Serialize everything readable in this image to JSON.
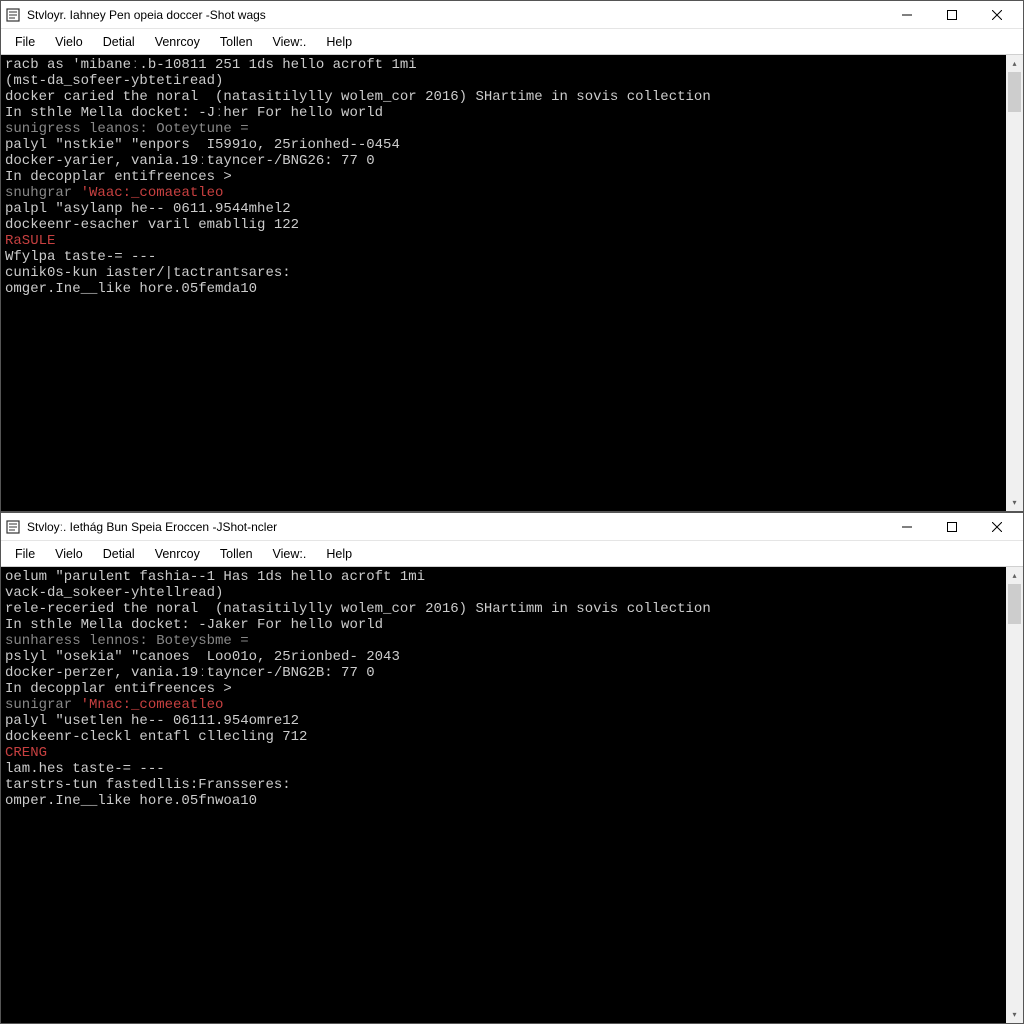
{
  "windows": [
    {
      "title": "Stvloyr. Iahney Pen opeia doccer -Shot wags",
      "menu": [
        "File",
        "Vielo",
        "Detial",
        "Venrcoy",
        "Tollen",
        "View:.",
        "Help"
      ],
      "lines": [
        {
          "segs": [
            {
              "t": "racb as 'mibaneː.b-10811 251 1ds hello acroft 1mi",
              "c": "white"
            }
          ]
        },
        {
          "segs": [
            {
              "t": "(mst-da_sofeer-ybtetiread)",
              "c": "white"
            }
          ]
        },
        {
          "segs": [
            {
              "t": "",
              "c": "white"
            }
          ]
        },
        {
          "segs": [
            {
              "t": "docker caried the noral  (natasitilylly wolem_cor 2016) SHartime in sovis collection",
              "c": "white"
            }
          ]
        },
        {
          "segs": [
            {
              "t": "",
              "c": "white"
            }
          ]
        },
        {
          "segs": [
            {
              "t": "In sthle Mella docket: -Jːher For hello world",
              "c": "white"
            }
          ]
        },
        {
          "segs": [
            {
              "t": "sunigress leanos: Ooteytune =",
              "c": "gray"
            }
          ]
        },
        {
          "segs": [
            {
              "t": "palyl \"nstkie\" \"enpors  I5991o, 25rionhed--0454",
              "c": "white"
            }
          ]
        },
        {
          "segs": [
            {
              "t": "docker-yarier, vania.19ːtayncer-/BNG26: 77 0",
              "c": "white"
            }
          ]
        },
        {
          "segs": [
            {
              "t": "",
              "c": "white"
            }
          ]
        },
        {
          "segs": [
            {
              "t": "In decopplar entifreences >",
              "c": "white"
            }
          ]
        },
        {
          "segs": [
            {
              "t": "snuhgrar ",
              "c": "gray"
            },
            {
              "t": "'Waac:_comaeatleo",
              "c": "red"
            }
          ]
        },
        {
          "segs": [
            {
              "t": "palpl \"asylanp he-- 0611.9544mhel2",
              "c": "white"
            }
          ]
        },
        {
          "segs": [
            {
              "t": "dockeenr-esacher varil emabllig 122",
              "c": "white"
            }
          ]
        },
        {
          "segs": [
            {
              "t": "RaSULE",
              "c": "red"
            }
          ]
        },
        {
          "segs": [
            {
              "t": "Wfylpa taste-= ---",
              "c": "white"
            }
          ]
        },
        {
          "segs": [
            {
              "t": "cunik0s-kun iaster/|tactrantsares:",
              "c": "white"
            }
          ]
        },
        {
          "segs": [
            {
              "t": "omger.Ine__like hore.05femda10",
              "c": "white"
            }
          ]
        }
      ]
    },
    {
      "title": "Stvloyː. Iethág Bun Speia Eroccen -JShot-ncler",
      "menu": [
        "File",
        "Vielo",
        "Detial",
        "Venrcoy",
        "Tollen",
        "View:.",
        "Help"
      ],
      "lines": [
        {
          "segs": [
            {
              "t": "oelum \"parulent fashia--1 Has 1ds hello acroft 1mi",
              "c": "white"
            }
          ]
        },
        {
          "segs": [
            {
              "t": "vack-da_sokeer-yhtellread)",
              "c": "white"
            }
          ]
        },
        {
          "segs": [
            {
              "t": "",
              "c": "white"
            }
          ]
        },
        {
          "segs": [
            {
              "t": "rele-receried the noral  (natasitilylly wolem_cor 2016) SHartimm in sovis collection",
              "c": "white"
            }
          ]
        },
        {
          "segs": [
            {
              "t": "",
              "c": "white"
            }
          ]
        },
        {
          "segs": [
            {
              "t": "In sthle Mella docket: -Jaker For hello world",
              "c": "white"
            }
          ]
        },
        {
          "segs": [
            {
              "t": "sunharess lennos: Boteysbme =",
              "c": "gray"
            }
          ]
        },
        {
          "segs": [
            {
              "t": "pslyl \"osekia\" \"canoes  Loo01o, 25rionbed- 2043",
              "c": "white"
            }
          ]
        },
        {
          "segs": [
            {
              "t": "docker-perzer, vania.19ːtayncer-/BNG2B: 77 0",
              "c": "white"
            }
          ]
        },
        {
          "segs": [
            {
              "t": "",
              "c": "white"
            }
          ]
        },
        {
          "segs": [
            {
              "t": "In decopplar entifreences >",
              "c": "white"
            }
          ]
        },
        {
          "segs": [
            {
              "t": "sunigrar ",
              "c": "gray"
            },
            {
              "t": "'Mnac:_comeeatleo",
              "c": "red"
            }
          ]
        },
        {
          "segs": [
            {
              "t": "palyl \"usetlen he-- 06111.954omre12",
              "c": "white"
            }
          ]
        },
        {
          "segs": [
            {
              "t": "dockeenr-cleckl entafl cllecling 712",
              "c": "white"
            }
          ]
        },
        {
          "segs": [
            {
              "t": "CRENG",
              "c": "red"
            }
          ]
        },
        {
          "segs": [
            {
              "t": "lam.hes taste-= ---",
              "c": "white"
            }
          ]
        },
        {
          "segs": [
            {
              "t": "tarstrs-tun fastedllis:Fransseres:",
              "c": "white"
            }
          ]
        },
        {
          "segs": [
            {
              "t": "omper.Ine__like hore.05fnwoa10",
              "c": "white"
            }
          ]
        }
      ]
    }
  ]
}
